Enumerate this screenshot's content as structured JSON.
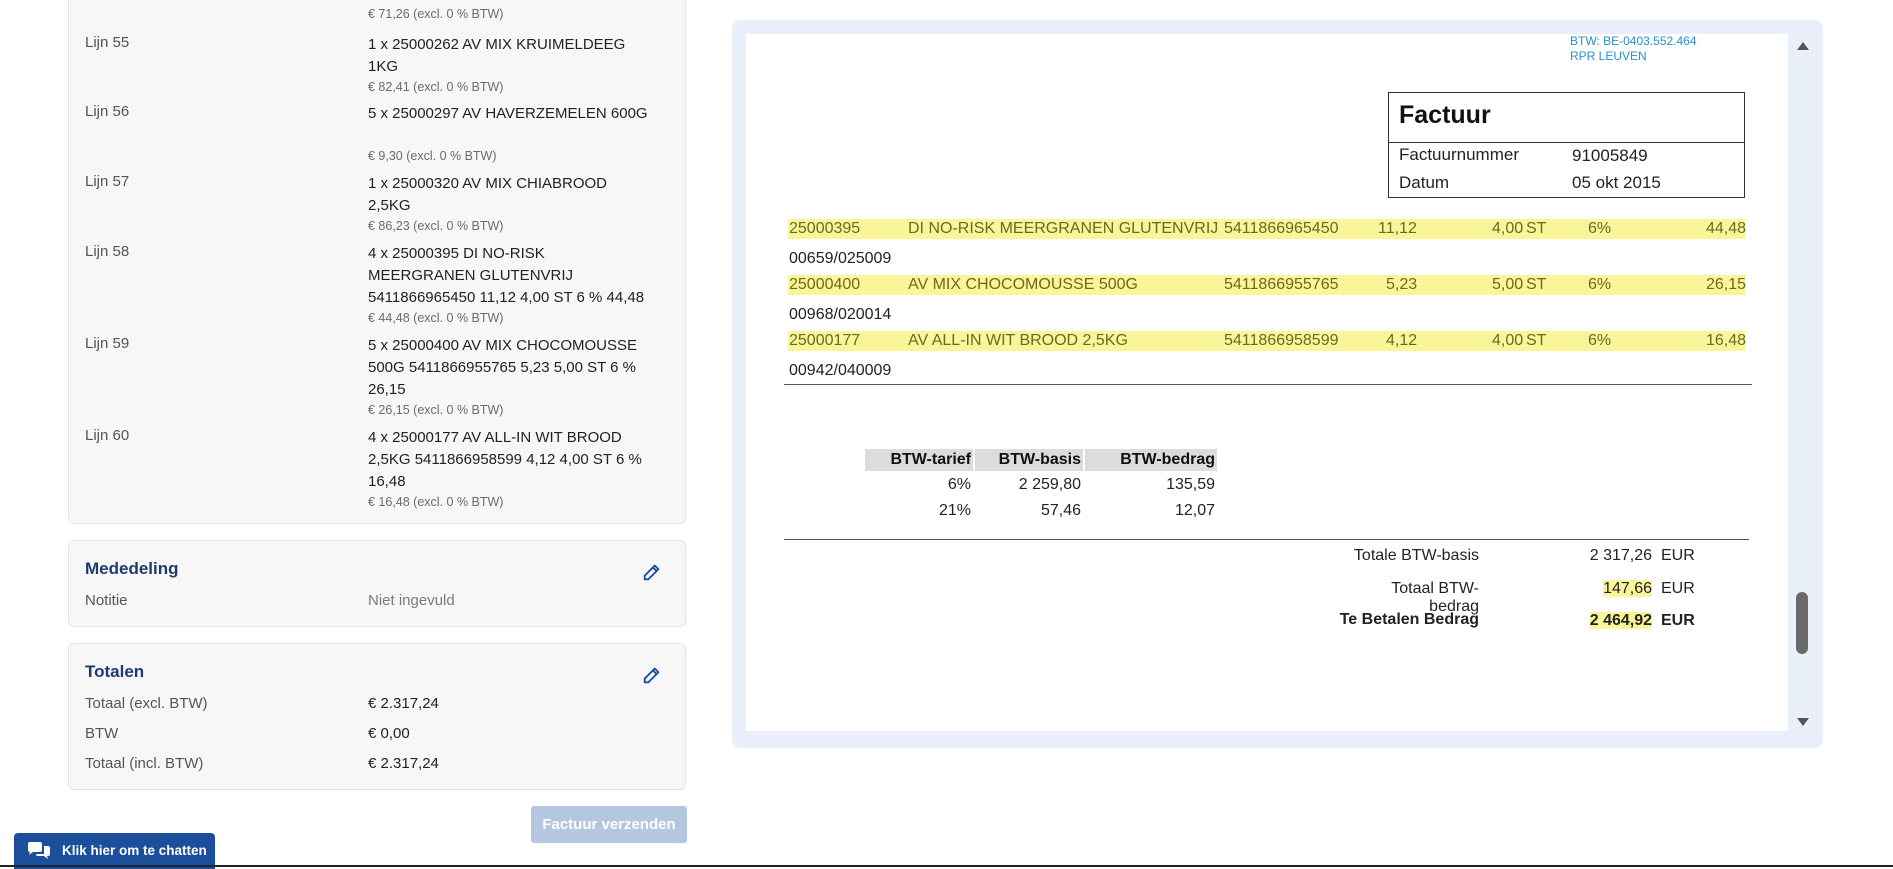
{
  "lines": [
    {
      "price": "€ 71,26 (excl. 0 % BTW)"
    },
    {
      "label": "Lijn 55",
      "desc": "1 x 25000262 AV MIX KRUIMELDEEG 1KG",
      "price": "€ 82,41 (excl. 0 % BTW)"
    },
    {
      "label": "Lijn 56",
      "desc": "5 x 25000297 AV HAVERZEMELEN 600G",
      "price": "€ 9,30 (excl. 0 % BTW)"
    },
    {
      "label": "Lijn 57",
      "desc": "1 x 25000320 AV MIX CHIABROOD 2,5KG",
      "price": "€ 86,23 (excl. 0 % BTW)"
    },
    {
      "label": "Lijn 58",
      "desc": "4 x 25000395 DI NO-RISK MEERGRANEN GLUTENVRIJ 5411866965450 11,12 4,00 ST 6 % 44,48",
      "price": "€ 44,48 (excl. 0 % BTW)"
    },
    {
      "label": "Lijn 59",
      "desc": "5 x 25000400 AV MIX CHOCOMOUSSE 500G 5411866955765 5,23 5,00 ST 6 % 26,15",
      "price": "€ 26,15 (excl. 0 % BTW)"
    },
    {
      "label": "Lijn 60",
      "desc": "4 x 25000177 AV ALL-IN WIT BROOD 2,5KG 5411866958599 4,12 4,00 ST 6 % 16,48",
      "price": "€ 16,48 (excl. 0 % BTW)"
    }
  ],
  "mededeling": {
    "title": "Mededeling",
    "notitie_label": "Notitie",
    "notitie_value": "Niet ingevuld"
  },
  "totalen": {
    "title": "Totalen",
    "rows": [
      {
        "label": "Totaal (excl. BTW)",
        "value": "€ 2.317,24"
      },
      {
        "label": "BTW",
        "value": "€ 0,00"
      },
      {
        "label": "Totaal (incl. BTW)",
        "value": "€ 2.317,24"
      }
    ]
  },
  "send_button": "Factuur verzenden",
  "chat_button": "Klik hier om te chatten",
  "pdf": {
    "btw_number": "BTW: BE-0403.552.464",
    "rpr": "RPR LEUVEN",
    "factuur_title": "Factuur",
    "factuurnummer_label": "Factuurnummer",
    "factuurnummer": "91005849",
    "datum_label": "Datum",
    "datum": "05 okt 2015",
    "items": [
      {
        "code": "25000395",
        "desc": "DI NO-RISK MEERGRANEN GLUTENVRIJ",
        "ean": "5411866965450",
        "price": "11,12",
        "qty": "4,00",
        "unit": "ST",
        "vat": "6%",
        "total": "44,48",
        "ref": "00659/025009"
      },
      {
        "code": "25000400",
        "desc": "AV MIX CHOCOMOUSSE 500G",
        "ean": "5411866955765",
        "price": "5,23",
        "qty": "5,00",
        "unit": "ST",
        "vat": "6%",
        "total": "26,15",
        "ref": "00968/020014"
      },
      {
        "code": "25000177",
        "desc": "AV ALL-IN WIT BROOD 2,5KG",
        "ean": "5411866958599",
        "price": "4,12",
        "qty": "4,00",
        "unit": "ST",
        "vat": "6%",
        "total": "16,48",
        "ref": "00942/040009"
      }
    ],
    "btw_table": {
      "headers": [
        "BTW-tarief",
        "BTW-basis",
        "BTW-bedrag"
      ],
      "rows": [
        [
          "6%",
          "2 259,80",
          "135,59"
        ],
        [
          "21%",
          "57,46",
          "12,07"
        ]
      ]
    },
    "totals": [
      {
        "label": "Totale BTW-basis",
        "value": "2 317,26",
        "currency": "EUR"
      },
      {
        "label": "Totaal BTW-bedrag",
        "value": "147,66",
        "currency": "EUR"
      },
      {
        "label": "Te Betalen Bedrag",
        "value": "2 464,92",
        "currency": "EUR"
      }
    ]
  },
  "colors": {
    "accent": "#1b4f9c",
    "title_blue": "#1f3a6e",
    "highlight": "#fbf59a",
    "btw_link": "#2a8ed6",
    "disabled_button": "#b5c6e0"
  }
}
